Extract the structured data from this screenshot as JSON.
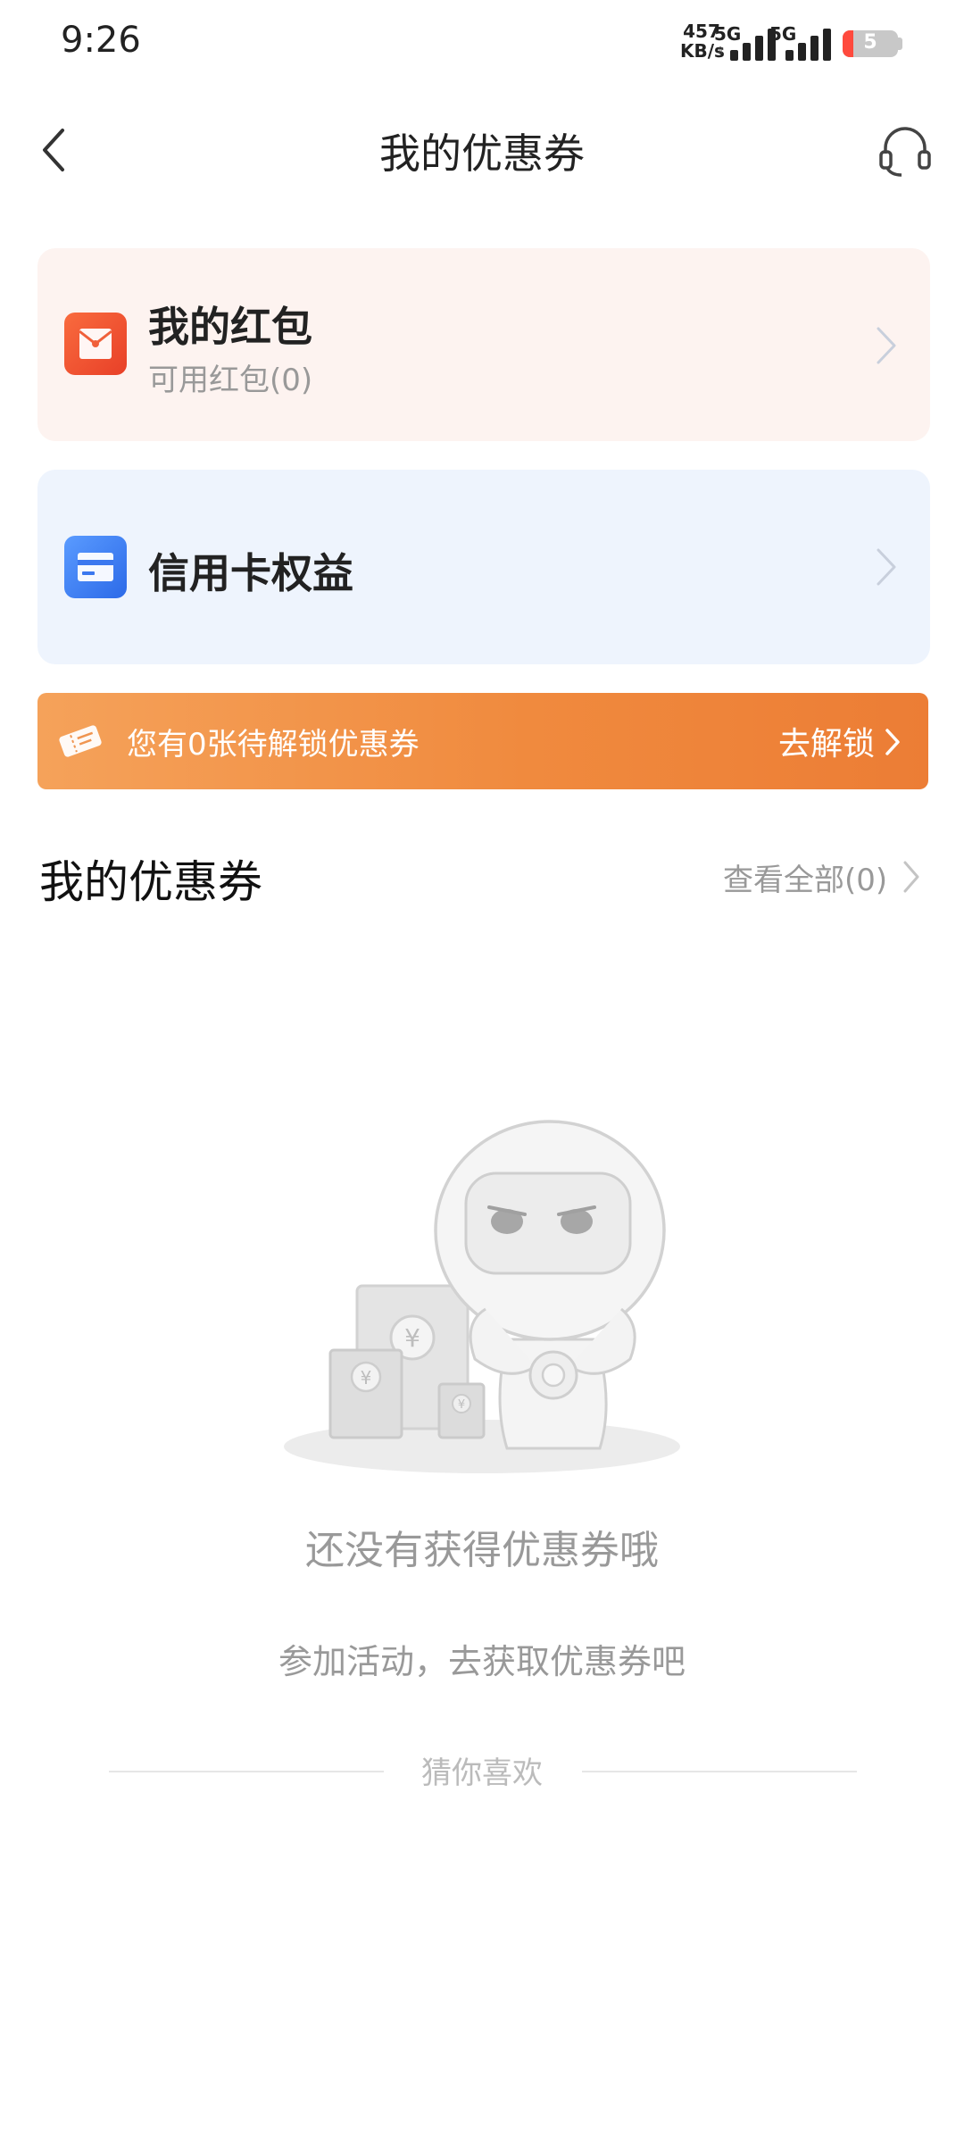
{
  "status_bar": {
    "time": "9:26",
    "net_speed_value": "457",
    "net_speed_unit": "KB/s",
    "sim1_label": "5G",
    "sim2_label": "5G",
    "battery_level": "5"
  },
  "nav": {
    "title": "我的优惠券",
    "back_icon": "chevron-left-icon",
    "service_icon": "headset-icon"
  },
  "cards": {
    "red_packet": {
      "title": "我的红包",
      "subtitle": "可用红包(0)",
      "icon": "red-envelope-icon"
    },
    "credit_card": {
      "title": "信用卡权益",
      "icon": "card-icon"
    }
  },
  "banner": {
    "text": "您有0张待解锁优惠券",
    "action": "去解锁",
    "icon": "ticket-icon"
  },
  "coupons": {
    "section_title": "我的优惠券",
    "view_all": "查看全部(0)"
  },
  "empty_state": {
    "title": "还没有获得优惠券哦",
    "subtitle": "参加活动，去获取优惠券吧",
    "illustration_symbol": "¥"
  },
  "recommend": {
    "label": "猜你喜欢"
  },
  "colors": {
    "banner_start": "#f5a25a",
    "banner_end": "#ec7d35",
    "red_card_bg": "#fdf3f0",
    "blue_card_bg": "#eef4fd",
    "red_icon": "#e84028",
    "blue_icon": "#2c6ae8"
  }
}
